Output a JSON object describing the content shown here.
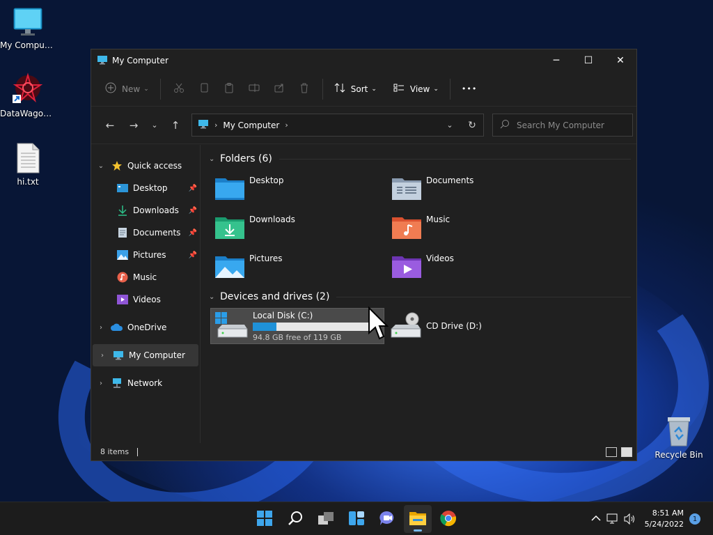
{
  "desktop": {
    "icons": [
      {
        "label": "My Computer"
      },
      {
        "label": "DataWagon..."
      },
      {
        "label": "hi.txt"
      },
      {
        "label": "Recycle Bin"
      }
    ]
  },
  "window": {
    "title": "My Computer",
    "controls": {
      "minimize": "─",
      "maximize": "☐",
      "close": "✕"
    }
  },
  "commandbar": {
    "new_label": "New",
    "sort_label": "Sort",
    "view_label": "View",
    "more_label": "•••"
  },
  "navbar": {
    "breadcrumb": [
      "My Computer"
    ],
    "search_placeholder": "Search My Computer"
  },
  "sidebar": {
    "quick_access": "Quick access",
    "quick_items": [
      {
        "label": "Desktop",
        "icon": "desktop-folder-icon"
      },
      {
        "label": "Downloads",
        "icon": "download-icon"
      },
      {
        "label": "Documents",
        "icon": "documents-icon"
      },
      {
        "label": "Pictures",
        "icon": "pictures-icon"
      },
      {
        "label": "Music",
        "icon": "music-icon"
      },
      {
        "label": "Videos",
        "icon": "videos-icon"
      }
    ],
    "onedrive": "OneDrive",
    "mycomputer": "My Computer",
    "network": "Network"
  },
  "content": {
    "folders_header": "Folders (6)",
    "folders": [
      {
        "name": "Desktop"
      },
      {
        "name": "Documents"
      },
      {
        "name": "Downloads"
      },
      {
        "name": "Music"
      },
      {
        "name": "Pictures"
      },
      {
        "name": "Videos"
      }
    ],
    "drives_header": "Devices and drives (2)",
    "drives": [
      {
        "name": "Local Disk (C:)",
        "free_text": "94.8 GB free of 119 GB",
        "used_fraction": 0.2
      },
      {
        "name": "CD Drive (D:)"
      }
    ]
  },
  "statusbar": {
    "items_text": "8 items"
  },
  "taskbar": {
    "time": "8:51 AM",
    "date": "5/24/2022",
    "notification_count": "1"
  },
  "colors": {
    "accent": "#1f91d8",
    "window_bg": "#202020",
    "taskbar_bg": "#1c1c1c"
  }
}
